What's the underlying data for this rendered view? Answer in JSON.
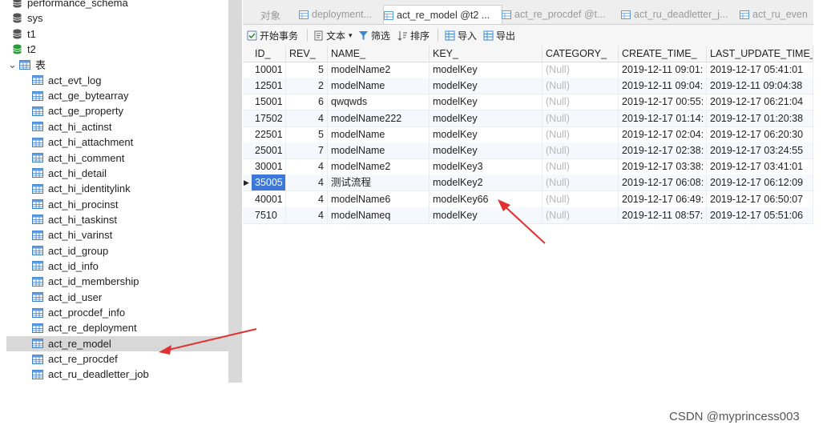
{
  "tree": {
    "items": [
      {
        "label": "performance_schema",
        "kind": "db-gray"
      },
      {
        "label": "sys",
        "kind": "db-gray"
      },
      {
        "label": "t1",
        "kind": "db-gray"
      },
      {
        "label": "t2",
        "kind": "db-green"
      },
      {
        "label": "表",
        "kind": "tables-folder"
      },
      {
        "label": "act_evt_log",
        "kind": "table"
      },
      {
        "label": "act_ge_bytearray",
        "kind": "table"
      },
      {
        "label": "act_ge_property",
        "kind": "table"
      },
      {
        "label": "act_hi_actinst",
        "kind": "table"
      },
      {
        "label": "act_hi_attachment",
        "kind": "table"
      },
      {
        "label": "act_hi_comment",
        "kind": "table"
      },
      {
        "label": "act_hi_detail",
        "kind": "table"
      },
      {
        "label": "act_hi_identitylink",
        "kind": "table"
      },
      {
        "label": "act_hi_procinst",
        "kind": "table"
      },
      {
        "label": "act_hi_taskinst",
        "kind": "table"
      },
      {
        "label": "act_hi_varinst",
        "kind": "table"
      },
      {
        "label": "act_id_group",
        "kind": "table"
      },
      {
        "label": "act_id_info",
        "kind": "table"
      },
      {
        "label": "act_id_membership",
        "kind": "table"
      },
      {
        "label": "act_id_user",
        "kind": "table"
      },
      {
        "label": "act_procdef_info",
        "kind": "table"
      },
      {
        "label": "act_re_deployment",
        "kind": "table"
      },
      {
        "label": "act_re_model",
        "kind": "table",
        "selected": true
      },
      {
        "label": "act_re_procdef",
        "kind": "table"
      },
      {
        "label": "act_ru_deadletter_job",
        "kind": "table"
      }
    ]
  },
  "tabs": [
    {
      "label": "对象",
      "active": false
    },
    {
      "label": "deployment...",
      "active": false
    },
    {
      "label": "act_re_model @t2 ...",
      "active": true
    },
    {
      "label": "act_re_procdef @t...",
      "active": false
    },
    {
      "label": "act_ru_deadletter_j...",
      "active": false
    },
    {
      "label": "act_ru_even",
      "active": false
    }
  ],
  "toolbar": {
    "begin_transaction": "开始事务",
    "text": "文本",
    "filter": "筛选",
    "sort": "排序",
    "import": "导入",
    "export": "导出"
  },
  "grid": {
    "columns": [
      "ID_",
      "REV_",
      "NAME_",
      "KEY_",
      "CATEGORY_",
      "CREATE_TIME_",
      "LAST_UPDATE_TIME_"
    ],
    "rows": [
      {
        "id": "10001",
        "rev": "5",
        "name": "modelName2",
        "key": "modelKey",
        "category": "(Null)",
        "create": "2019-12-11 09:01:",
        "update": "2019-12-17 05:41:01"
      },
      {
        "id": "12501",
        "rev": "2",
        "name": "modelName",
        "key": "modelKey",
        "category": "(Null)",
        "create": "2019-12-11 09:04:",
        "update": "2019-12-11 09:04:38"
      },
      {
        "id": "15001",
        "rev": "6",
        "name": "qwqwds",
        "key": "modelKey",
        "category": "(Null)",
        "create": "2019-12-17 00:55:",
        "update": "2019-12-17 06:21:04"
      },
      {
        "id": "17502",
        "rev": "4",
        "name": "modelName222",
        "key": "modelKey",
        "category": "(Null)",
        "create": "2019-12-17 01:14:",
        "update": "2019-12-17 01:20:38"
      },
      {
        "id": "22501",
        "rev": "5",
        "name": "modelName",
        "key": "modelKey",
        "category": "(Null)",
        "create": "2019-12-17 02:04:",
        "update": "2019-12-17 06:20:30"
      },
      {
        "id": "25001",
        "rev": "7",
        "name": "modelName",
        "key": "modelKey",
        "category": "(Null)",
        "create": "2019-12-17 02:38:",
        "update": "2019-12-17 03:24:55"
      },
      {
        "id": "30001",
        "rev": "4",
        "name": "modelName2",
        "key": "modelKey3",
        "category": "(Null)",
        "create": "2019-12-17 03:38:",
        "update": "2019-12-17 03:41:01"
      },
      {
        "id": "35005",
        "rev": "4",
        "name": "测试流程",
        "key": "modelKey2",
        "category": "(Null)",
        "create": "2019-12-17 06:08:",
        "update": "2019-12-17 06:12:09",
        "selected": true
      },
      {
        "id": "40001",
        "rev": "4",
        "name": "modelName6",
        "key": "modelKey66",
        "category": "(Null)",
        "create": "2019-12-17 06:49:",
        "update": "2019-12-17 06:50:07"
      },
      {
        "id": "7510",
        "rev": "4",
        "name": "modelNameq",
        "key": "modelKey",
        "category": "(Null)",
        "create": "2019-12-11 08:57:",
        "update": "2019-12-17 05:51:06"
      }
    ]
  },
  "watermark": "CSDN @myprincess003",
  "colors": {
    "selection": "#3d78d8",
    "annotation_arrow": "#e03030",
    "db_green": "#2e9b3b"
  }
}
